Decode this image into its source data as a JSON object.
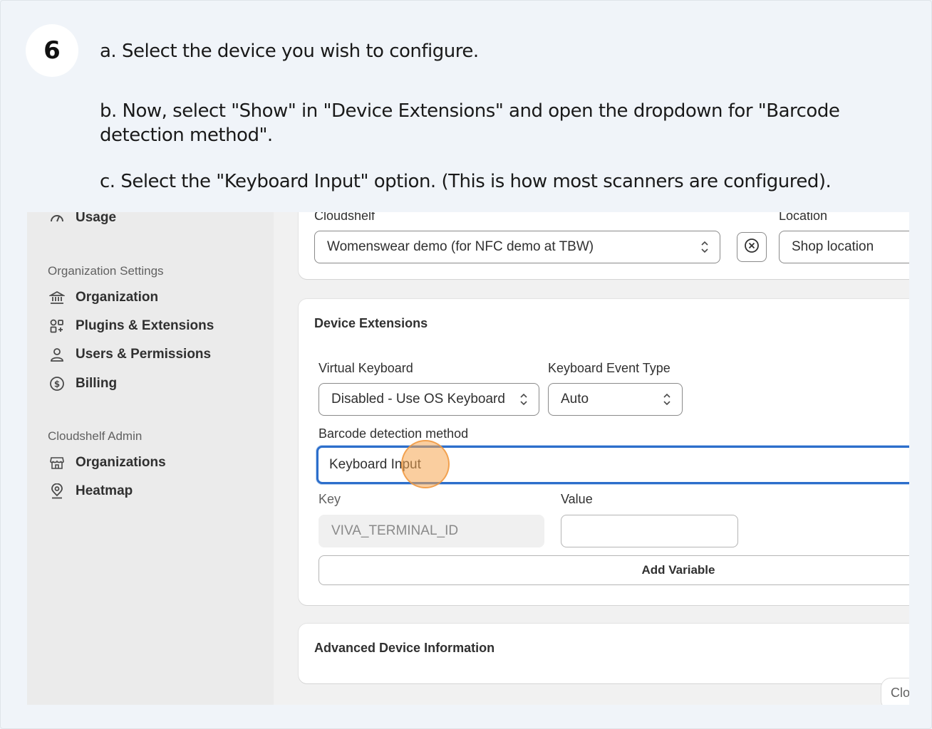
{
  "step": {
    "number": "6"
  },
  "instructions": {
    "a": "a. Select the device you wish to configure.",
    "b": "b. Now, select \"Show\" in \"Device Extensions\" and open the dropdown for \"Barcode detection method\".",
    "c": "c. Select the \"Keyboard Input\" option. (This is how most scanners are configured)."
  },
  "sidebar": {
    "top_item": {
      "label": "Usage",
      "icon": "gauge-icon"
    },
    "org_section": {
      "title": "Organization Settings",
      "items": [
        {
          "label": "Organization",
          "icon": "bank-icon"
        },
        {
          "label": "Plugins & Extensions",
          "icon": "plugins-icon"
        },
        {
          "label": "Users & Permissions",
          "icon": "user-icon"
        },
        {
          "label": "Billing",
          "icon": "dollar-icon"
        }
      ]
    },
    "admin_section": {
      "title": "Cloudshelf Admin",
      "items": [
        {
          "label": "Organizations",
          "icon": "store-icon"
        },
        {
          "label": "Heatmap",
          "icon": "map-pin-icon"
        }
      ]
    }
  },
  "device_card": {
    "cloudshelf_label": "Cloudshelf",
    "cloudshelf_value": "Womenswear demo (for NFC demo at TBW)",
    "location_label": "Location",
    "location_value": "Shop location"
  },
  "extensions_card": {
    "heading": "Device Extensions",
    "virtual_keyboard_label": "Virtual Keyboard",
    "virtual_keyboard_value": "Disabled - Use OS Keyboard",
    "event_type_label": "Keyboard Event Type",
    "event_type_value": "Auto",
    "barcode_label": "Barcode detection method",
    "barcode_value": "Keyboard Input",
    "key_label": "Key",
    "key_value": "VIVA_TERMINAL_ID",
    "value_label": "Value",
    "value_value": "",
    "add_variable": "Add Variable"
  },
  "advanced_card": {
    "heading": "Advanced Device Information"
  },
  "corner_button": "Clo",
  "colors": {
    "focus": "#2c6ecb",
    "click_marker": "#f5a650",
    "background": "#f0f4f9"
  }
}
